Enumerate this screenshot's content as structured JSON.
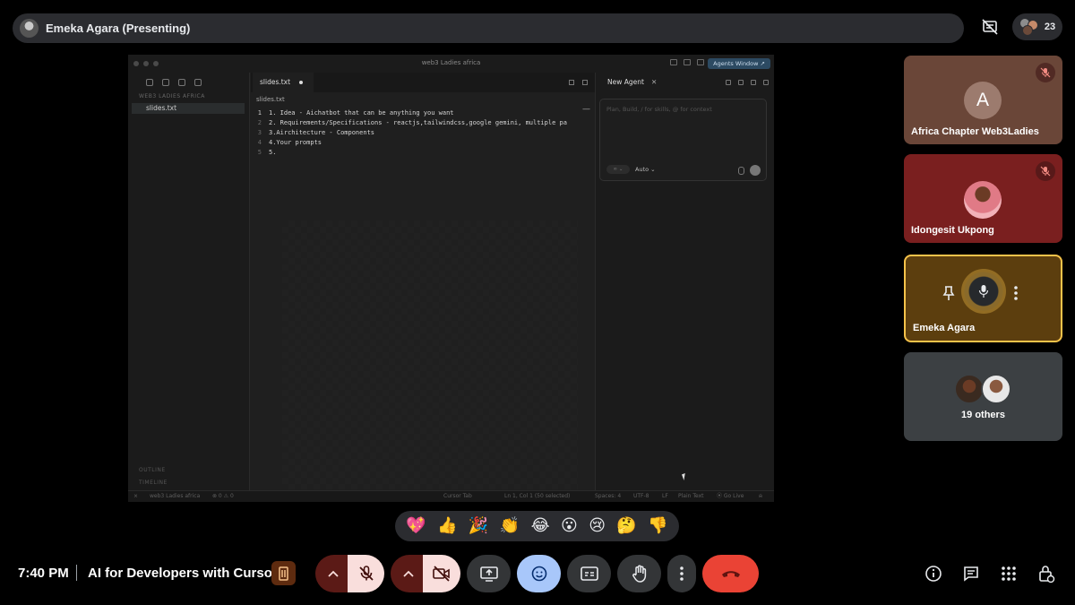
{
  "presenter": {
    "name": "Emeka Agara (Presenting)"
  },
  "participants": {
    "count": "23"
  },
  "shared_screen": {
    "window_title": "web3 Ladies africa",
    "agents_window_label": "Agents Window ↗",
    "explorer_heading": "WEB3 LADIES AFRICA",
    "file_name": "slides.txt",
    "tab_name": "slides.txt",
    "breadcrumb": "slides.txt",
    "outline_label": "OUTLINE",
    "timeline_label": "TIMELINE",
    "code_lines": [
      {
        "num": "1",
        "text": "1. Idea - Aichatbot that can be anything you want"
      },
      {
        "num": "2",
        "text": "2. Requirements/Specifications - reactjs,tailwindcss,google gemini, multiple pa"
      },
      {
        "num": "3",
        "text": "3.Airchitecture - Components"
      },
      {
        "num": "4",
        "text": "4.Your prompts"
      },
      {
        "num": "5",
        "text": "5."
      }
    ],
    "agent_tab": "New Agent",
    "agent_placeholder": "Plan, Build, / for skills, @ for context",
    "agent_chip": "∞ ⌄",
    "agent_mode": "Auto ⌄",
    "status": {
      "workspace": "web3 Ladies africa",
      "problems": "⊗ 0 ⚠ 0",
      "cursor_tab": "Cursor Tab",
      "position": "Ln 1, Col 1 (50 selected)",
      "spaces": "Spaces: 4",
      "encoding": "UTF-8",
      "eol": "LF",
      "language": "Plain Text",
      "go_live": "⦿ Go Live"
    }
  },
  "tiles": [
    {
      "name": "Africa Chapter Web3Ladies",
      "avatar_letter": "A",
      "muted": true
    },
    {
      "name": "Idongesit Ukpong",
      "muted": true
    },
    {
      "name": "Emeka Agara",
      "speaking": true
    },
    {
      "name": "19 others"
    }
  ],
  "reactions": [
    "💖",
    "👍",
    "🎉",
    "👏",
    "😂",
    "😮",
    "😢",
    "🤔",
    "👎"
  ],
  "bottom_bar": {
    "time": "7:40 PM",
    "meeting_title": "AI for Developers with Cursor"
  },
  "colors": {
    "accent_blue": "#a8c7fa",
    "hangup_red": "#ea4335",
    "speaking_border": "#f7c34a"
  }
}
